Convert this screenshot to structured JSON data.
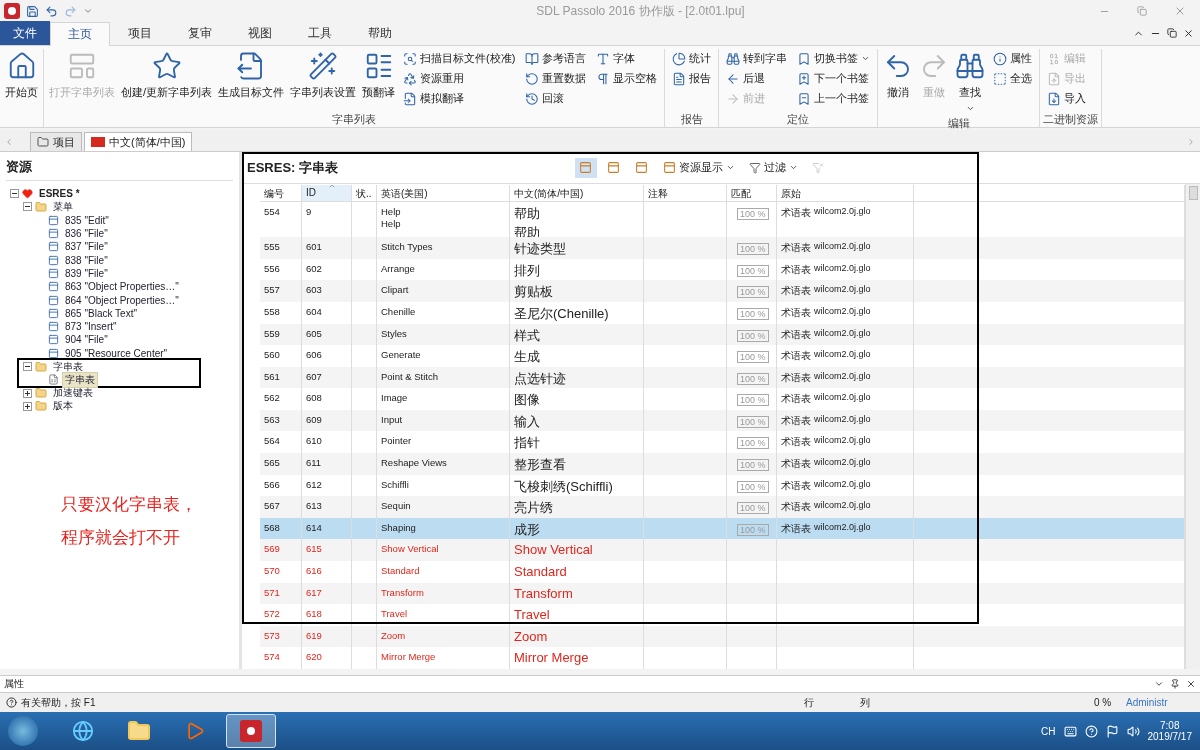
{
  "window": {
    "title": "SDL Passolo 2016 协作版 - [2.0t01.lpu]"
  },
  "menu_tabs": [
    {
      "label": "文件",
      "kind": "file",
      "selected": false
    },
    {
      "label": "主页",
      "kind": "tab",
      "selected": true
    },
    {
      "label": "项目",
      "kind": "tab",
      "selected": false
    },
    {
      "label": "复审",
      "kind": "tab",
      "selected": false
    },
    {
      "label": "视图",
      "kind": "tab",
      "selected": false
    },
    {
      "label": "工具",
      "kind": "tab",
      "selected": false
    },
    {
      "label": "帮助",
      "kind": "tab",
      "selected": false
    }
  ],
  "ribbon": {
    "groups": [
      {
        "items": [
          {
            "kind": "large",
            "label": "开始页",
            "disabled": false
          }
        ]
      },
      {
        "label": "字串列表",
        "items": [
          {
            "kind": "large",
            "label": "打开字串列表",
            "disabled": true
          },
          {
            "kind": "large",
            "label": "创建/更新字串列表",
            "disabled": false
          },
          {
            "kind": "large",
            "label": "生成目标文件",
            "disabled": false
          },
          {
            "kind": "large",
            "label": "字串列表设置",
            "disabled": false
          },
          {
            "kind": "large",
            "label": "预翻译",
            "disabled": false
          },
          {
            "kind": "small",
            "label": "扫描目标文件(校准)",
            "disabled": false
          },
          {
            "kind": "small",
            "label": "资源重用",
            "disabled": false
          },
          {
            "kind": "small",
            "label": "模拟翻译",
            "disabled": false
          },
          {
            "kind": "small",
            "label": "参考语言",
            "disabled": false
          },
          {
            "kind": "small",
            "label": "重置数据",
            "disabled": false
          },
          {
            "kind": "small",
            "label": "回滚",
            "disabled": false
          },
          {
            "kind": "small",
            "label": "字体",
            "disabled": false
          },
          {
            "kind": "small",
            "label": "显示空格",
            "disabled": false
          }
        ]
      },
      {
        "label": "报告",
        "items": [
          {
            "kind": "small",
            "label": "统计",
            "disabled": false
          },
          {
            "kind": "small",
            "label": "报告",
            "disabled": false
          }
        ]
      },
      {
        "label": "定位",
        "items": [
          {
            "kind": "small",
            "label": "转到字串",
            "disabled": false
          },
          {
            "kind": "small",
            "label": "后退",
            "disabled": false
          },
          {
            "kind": "small",
            "label": "前进",
            "disabled": true
          },
          {
            "kind": "small",
            "label": "切换书签",
            "disabled": false,
            "dropdown": true
          },
          {
            "kind": "small",
            "label": "下一个书签",
            "disabled": false
          },
          {
            "kind": "small",
            "label": "上一个书签",
            "disabled": false
          }
        ]
      },
      {
        "label": "编辑",
        "items": [
          {
            "kind": "large",
            "label": "撤消",
            "disabled": false
          },
          {
            "kind": "large",
            "label": "重做",
            "disabled": true
          },
          {
            "kind": "large",
            "label": "查找",
            "disabled": false,
            "dropdown": true
          },
          {
            "kind": "small",
            "label": "属性",
            "disabled": false
          },
          {
            "kind": "small",
            "label": "全选",
            "disabled": false
          }
        ]
      },
      {
        "label": "二进制资源",
        "items": [
          {
            "kind": "small",
            "label": "编辑",
            "disabled": true
          },
          {
            "kind": "small",
            "label": "导出",
            "disabled": true
          },
          {
            "kind": "small",
            "label": "导入",
            "disabled": false
          }
        ]
      }
    ]
  },
  "doc_tabs": [
    {
      "label": "项目",
      "kind": "project",
      "selected": false
    },
    {
      "label": "中文(简体/中国)",
      "kind": "language",
      "selected": true
    }
  ],
  "resources": {
    "title": "资源",
    "tree": [
      {
        "label": "ESRES *",
        "kind": "root",
        "expanded": true,
        "selected": false,
        "children": [
          {
            "label": "菜单",
            "kind": "folder",
            "expanded": true,
            "selected": false,
            "children": [
              {
                "label": "835 \"Edit\"",
                "kind": "menu",
                "selected": false
              },
              {
                "label": "836 \"File\"",
                "kind": "menu",
                "selected": false
              },
              {
                "label": "837 \"File\"",
                "kind": "menu",
                "selected": false
              },
              {
                "label": "838 \"File\"",
                "kind": "menu",
                "selected": false
              },
              {
                "label": "839 \"File\"",
                "kind": "menu",
                "selected": false
              },
              {
                "label": "863 \"Object Properties…\"",
                "kind": "menu",
                "selected": false
              },
              {
                "label": "864 \"Object Properties…\"",
                "kind": "menu",
                "selected": false
              },
              {
                "label": "865 \"Black Text\"",
                "kind": "menu",
                "selected": false
              },
              {
                "label": "873 \"Insert\"",
                "kind": "menu",
                "selected": false
              },
              {
                "label": "904 \"File\"",
                "kind": "menu",
                "selected": false
              },
              {
                "label": "905 \"Resource Center\"",
                "kind": "menu",
                "selected": false
              }
            ]
          },
          {
            "label": "字串表",
            "kind": "folder",
            "expanded": true,
            "selected": false,
            "framed": true,
            "children": [
              {
                "label": "字串表",
                "kind": "strings",
                "selected": true
              }
            ]
          },
          {
            "label": "加速键表",
            "kind": "folder",
            "expanded": false,
            "selected": false
          },
          {
            "label": "版本",
            "kind": "folder",
            "expanded": false,
            "selected": false
          }
        ]
      }
    ],
    "annotation": [
      "只要汉化字串表，",
      "程序就会打不开"
    ]
  },
  "string_list": {
    "title": "ESRES: 字串表",
    "toolbar": [
      {
        "kind": "icon",
        "pressed": true
      },
      {
        "kind": "icon",
        "pressed": false
      },
      {
        "kind": "icon",
        "pressed": false
      },
      {
        "kind": "menu",
        "label": "资源显示"
      },
      {
        "kind": "filter",
        "label": "过滤"
      },
      {
        "kind": "clear",
        "disabled": true
      }
    ],
    "columns": [
      {
        "label": "编号",
        "sorted": false
      },
      {
        "label": "ID",
        "sorted": true
      },
      {
        "label": "状..",
        "sorted": false
      },
      {
        "label": "英语(美国)",
        "sorted": false
      },
      {
        "label": "中文(简体/中国)",
        "sorted": false
      },
      {
        "label": "注释",
        "sorted": false
      },
      {
        "label": "匹配",
        "sorted": false
      },
      {
        "label": "原始",
        "sorted": false
      }
    ],
    "rows": [
      {
        "no": "554",
        "id": "9",
        "source": [
          "Help",
          "Help"
        ],
        "target": [
          "帮助",
          "帮助"
        ],
        "match": "100 %",
        "origin": "术语表",
        "origin_file": "wilcom2.0j.glo",
        "kind": "translated",
        "selected": false
      },
      {
        "no": "555",
        "id": "601",
        "source": [
          "Stitch Types"
        ],
        "target": [
          "针迹类型"
        ],
        "match": "100 %",
        "origin": "术语表",
        "origin_file": "wilcom2.0j.glo",
        "kind": "translated",
        "selected": false
      },
      {
        "no": "556",
        "id": "602",
        "source": [
          "Arrange"
        ],
        "target": [
          "排列"
        ],
        "match": "100 %",
        "origin": "术语表",
        "origin_file": "wilcom2.0j.glo",
        "kind": "translated",
        "selected": false
      },
      {
        "no": "557",
        "id": "603",
        "source": [
          "Clipart"
        ],
        "target": [
          "剪贴板"
        ],
        "match": "100 %",
        "origin": "术语表",
        "origin_file": "wilcom2.0j.glo",
        "kind": "translated",
        "selected": false
      },
      {
        "no": "558",
        "id": "604",
        "source": [
          "Chenille"
        ],
        "target": [
          "圣尼尔(Chenille)"
        ],
        "match": "100 %",
        "origin": "术语表",
        "origin_file": "wilcom2.0j.glo",
        "kind": "translated",
        "selected": false
      },
      {
        "no": "559",
        "id": "605",
        "source": [
          "Styles"
        ],
        "target": [
          "样式"
        ],
        "match": "100 %",
        "origin": "术语表",
        "origin_file": "wilcom2.0j.glo",
        "kind": "translated",
        "selected": false
      },
      {
        "no": "560",
        "id": "606",
        "source": [
          "Generate"
        ],
        "target": [
          "生成"
        ],
        "match": "100 %",
        "origin": "术语表",
        "origin_file": "wilcom2.0j.glo",
        "kind": "translated",
        "selected": false
      },
      {
        "no": "561",
        "id": "607",
        "source": [
          "Point & Stitch"
        ],
        "target": [
          "点选针迹"
        ],
        "match": "100 %",
        "origin": "术语表",
        "origin_file": "wilcom2.0j.glo",
        "kind": "translated",
        "selected": false
      },
      {
        "no": "562",
        "id": "608",
        "source": [
          "Image"
        ],
        "target": [
          "图像"
        ],
        "match": "100 %",
        "origin": "术语表",
        "origin_file": "wilcom2.0j.glo",
        "kind": "translated",
        "selected": false
      },
      {
        "no": "563",
        "id": "609",
        "source": [
          "Input"
        ],
        "target": [
          "输入"
        ],
        "match": "100 %",
        "origin": "术语表",
        "origin_file": "wilcom2.0j.glo",
        "kind": "translated",
        "selected": false
      },
      {
        "no": "564",
        "id": "610",
        "source": [
          "Pointer"
        ],
        "target": [
          "指针"
        ],
        "match": "100 %",
        "origin": "术语表",
        "origin_file": "wilcom2.0j.glo",
        "kind": "translated",
        "selected": false
      },
      {
        "no": "565",
        "id": "611",
        "source": [
          "Reshape Views"
        ],
        "target": [
          "整形查看"
        ],
        "match": "100 %",
        "origin": "术语表",
        "origin_file": "wilcom2.0j.glo",
        "kind": "translated",
        "selected": false
      },
      {
        "no": "566",
        "id": "612",
        "source": [
          "Schiffli"
        ],
        "target": [
          "飞梭刺绣(Schiffli)"
        ],
        "match": "100 %",
        "origin": "术语表",
        "origin_file": "wilcom2.0j.glo",
        "kind": "translated",
        "selected": false
      },
      {
        "no": "567",
        "id": "613",
        "source": [
          "Sequin"
        ],
        "target": [
          "亮片绣"
        ],
        "match": "100 %",
        "origin": "术语表",
        "origin_file": "wilcom2.0j.glo",
        "kind": "translated",
        "selected": false
      },
      {
        "no": "568",
        "id": "614",
        "source": [
          "Shaping"
        ],
        "target": [
          "成形"
        ],
        "match": "100 %",
        "origin": "术语表",
        "origin_file": "wilcom2.0j.glo",
        "kind": "translated",
        "selected": true
      },
      {
        "no": "569",
        "id": "615",
        "source": [
          "Show Vertical"
        ],
        "target": [
          "Show Vertical"
        ],
        "kind": "untranslated",
        "selected": false
      },
      {
        "no": "570",
        "id": "616",
        "source": [
          "Standard"
        ],
        "target": [
          "Standard"
        ],
        "kind": "untranslated",
        "selected": false
      },
      {
        "no": "571",
        "id": "617",
        "source": [
          "Transform"
        ],
        "target": [
          "Transform"
        ],
        "kind": "untranslated",
        "selected": false
      },
      {
        "no": "572",
        "id": "618",
        "source": [
          "Travel"
        ],
        "target": [
          "Travel"
        ],
        "kind": "untranslated",
        "selected": false
      },
      {
        "no": "573",
        "id": "619",
        "source": [
          "Zoom"
        ],
        "target": [
          "Zoom"
        ],
        "kind": "untranslated",
        "selected": false
      },
      {
        "no": "574",
        "id": "620",
        "source": [
          "Mirror Merge"
        ],
        "target": [
          "Mirror Merge"
        ],
        "kind": "untranslated",
        "selected": false
      }
    ]
  },
  "properties_bar": {
    "title": "属性"
  },
  "status_bar": {
    "help": "有关帮助，按 F1",
    "row": "行",
    "column": "列",
    "percent": "0 %",
    "user": "Administr"
  },
  "taskbar": {
    "apps": [
      {
        "kind": "browser",
        "selected": false
      },
      {
        "kind": "folder",
        "selected": false
      },
      {
        "kind": "media",
        "selected": false
      },
      {
        "kind": "passolo",
        "selected": true
      }
    ],
    "language": "CH",
    "time": "7:08",
    "date": "2019/7/17"
  }
}
